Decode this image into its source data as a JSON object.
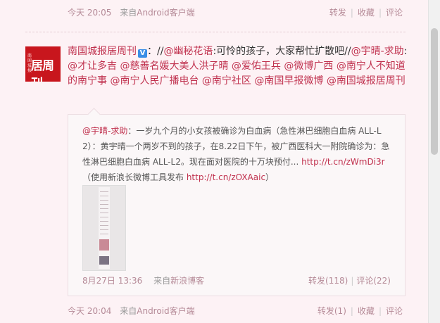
{
  "top_meta": {
    "time": "今天 20:05",
    "source_prefix": "来自",
    "source": "Android客户端",
    "repost": "转发",
    "favorite": "收藏",
    "comment": "评论"
  },
  "post": {
    "avatar_text": "居周刊",
    "avatar_small_text": "南国城报",
    "author": "南国城报居周刊",
    "verified_glyph": "V",
    "text_parts": [
      {
        "t": "：//",
        "link": false
      },
      {
        "t": "@幽秘花语",
        "link": true
      },
      {
        "t": ":可怜的孩子，大家帮忙扩散吧//",
        "link": false
      },
      {
        "t": "@宇晴-求助",
        "link": true
      },
      {
        "t": ": ",
        "link": false
      },
      {
        "t": "@才让多吉",
        "link": true
      },
      {
        "t": " ",
        "link": false
      },
      {
        "t": "@慈善名媛大美人洪子晴",
        "link": true
      },
      {
        "t": " ",
        "link": false
      },
      {
        "t": "@爱佑王兵",
        "link": true
      },
      {
        "t": " ",
        "link": false
      },
      {
        "t": "@微博广西",
        "link": true
      },
      {
        "t": " ",
        "link": false
      },
      {
        "t": "@南宁人不知道的南宁事",
        "link": true
      },
      {
        "t": " ",
        "link": false
      },
      {
        "t": "@南宁人民广播电台",
        "link": true
      },
      {
        "t": " ",
        "link": false
      },
      {
        "t": "@南宁社区",
        "link": true
      },
      {
        "t": " ",
        "link": false
      },
      {
        "t": "@南国早报微博",
        "link": true
      },
      {
        "t": " ",
        "link": false
      },
      {
        "t": "@南国城报居周刊",
        "link": true
      }
    ]
  },
  "repost": {
    "text_parts": [
      {
        "t": "@宇晴-求助",
        "link": true
      },
      {
        "t": "：一岁九个月的小女孩被确诊为白血病（急性淋巴细胞白血病 ALL-L2）：黄宇晴一个两岁不到的孩子，在8.22日下午，被广西医科大一附院确诊为：急性淋巴细胞白血病 ALL-L2。现在面对医院的十万块预付... ",
        "link": false
      },
      {
        "t": "http://t.cn/zWmDi3r",
        "link": true
      },
      {
        "t": "（使用新浪长微博工具发布 ",
        "link": false
      },
      {
        "t": "http://t.cn/zOXAaic",
        "link": true
      },
      {
        "t": "）",
        "link": false
      }
    ],
    "time": "8月27日 13:36",
    "source_prefix": "来自",
    "source": "新浪博客",
    "repost": "转发(118)",
    "comment": "评论(22)"
  },
  "bottom_meta": {
    "time": "今天 20:04",
    "source_prefix": "来自",
    "source": "Android客户端",
    "repost": "转发(1)",
    "favorite": "收藏",
    "comment": "评论"
  }
}
